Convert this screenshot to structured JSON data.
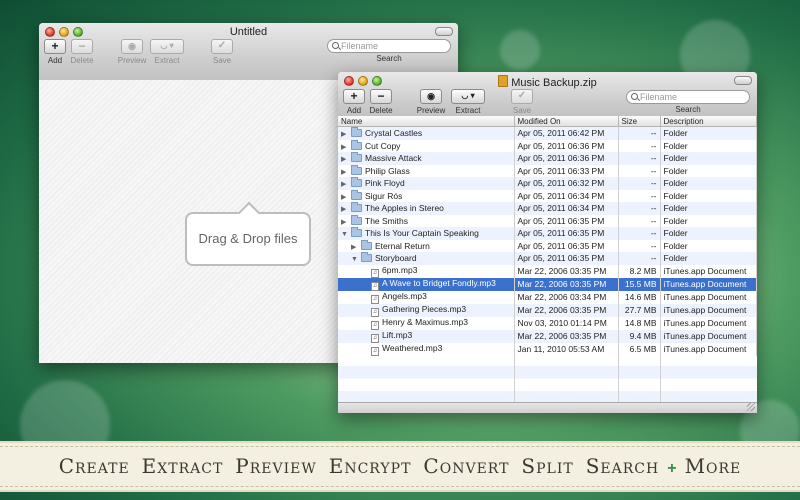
{
  "left_window": {
    "title": "Untitled",
    "toolbar": {
      "add": "Add",
      "delete": "Delete",
      "preview": "Preview",
      "extract": "Extract",
      "save": "Save"
    },
    "search": {
      "placeholder": "Filename",
      "label": "Search"
    },
    "drop_text": "Drag & Drop files"
  },
  "right_window": {
    "title": "Music Backup.zip",
    "toolbar": {
      "add": "Add",
      "delete": "Delete",
      "preview": "Preview",
      "extract": "Extract",
      "save": "Save"
    },
    "search": {
      "placeholder": "Filename",
      "label": "Search"
    },
    "columns": {
      "name": "Name",
      "modified": "Modified On",
      "size": "Size",
      "description": "Description"
    },
    "rows": [
      {
        "name": "Crystal Castles",
        "modified": "Apr 05, 2011 06:42 PM",
        "size": "--",
        "description": "Folder",
        "kind": "folder",
        "indent": 0,
        "disclosure": "closed"
      },
      {
        "name": "Cut Copy",
        "modified": "Apr 05, 2011 06:36 PM",
        "size": "--",
        "description": "Folder",
        "kind": "folder",
        "indent": 0,
        "disclosure": "closed"
      },
      {
        "name": "Massive Attack",
        "modified": "Apr 05, 2011 06:36 PM",
        "size": "--",
        "description": "Folder",
        "kind": "folder",
        "indent": 0,
        "disclosure": "closed"
      },
      {
        "name": "Philip Glass",
        "modified": "Apr 05, 2011 06:33 PM",
        "size": "--",
        "description": "Folder",
        "kind": "folder",
        "indent": 0,
        "disclosure": "closed"
      },
      {
        "name": "Pink Floyd",
        "modified": "Apr 05, 2011 06:32 PM",
        "size": "--",
        "description": "Folder",
        "kind": "folder",
        "indent": 0,
        "disclosure": "closed"
      },
      {
        "name": "Sigur Rós",
        "modified": "Apr 05, 2011 06:34 PM",
        "size": "--",
        "description": "Folder",
        "kind": "folder",
        "indent": 0,
        "disclosure": "closed"
      },
      {
        "name": "The Apples in Stereo",
        "modified": "Apr 05, 2011 06:34 PM",
        "size": "--",
        "description": "Folder",
        "kind": "folder",
        "indent": 0,
        "disclosure": "closed"
      },
      {
        "name": "The Smiths",
        "modified": "Apr 05, 2011 06:35 PM",
        "size": "--",
        "description": "Folder",
        "kind": "folder",
        "indent": 0,
        "disclosure": "closed"
      },
      {
        "name": "This Is Your Captain Speaking",
        "modified": "Apr 05, 2011 06:35 PM",
        "size": "--",
        "description": "Folder",
        "kind": "folder",
        "indent": 0,
        "disclosure": "open"
      },
      {
        "name": "Eternal Return",
        "modified": "Apr 05, 2011 06:35 PM",
        "size": "--",
        "description": "Folder",
        "kind": "folder",
        "indent": 1,
        "disclosure": "closed"
      },
      {
        "name": "Storyboard",
        "modified": "Apr 05, 2011 06:35 PM",
        "size": "--",
        "description": "Folder",
        "kind": "folder",
        "indent": 1,
        "disclosure": "open"
      },
      {
        "name": "6pm.mp3",
        "modified": "Mar 22, 2006 03:35 PM",
        "size": "8.2 MB",
        "description": "iTunes.app Document",
        "kind": "file",
        "indent": 2,
        "disclosure": "none"
      },
      {
        "name": "A Wave to Bridget Fondly.mp3",
        "modified": "Mar 22, 2006 03:35 PM",
        "size": "15.5 MB",
        "description": "iTunes.app Document",
        "kind": "file",
        "indent": 2,
        "disclosure": "none",
        "selected": true
      },
      {
        "name": "Angels.mp3",
        "modified": "Mar 22, 2006 03:34 PM",
        "size": "14.6 MB",
        "description": "iTunes.app Document",
        "kind": "file",
        "indent": 2,
        "disclosure": "none"
      },
      {
        "name": "Gathering Pieces.mp3",
        "modified": "Mar 22, 2006 03:35 PM",
        "size": "27.7 MB",
        "description": "iTunes.app Document",
        "kind": "file",
        "indent": 2,
        "disclosure": "none"
      },
      {
        "name": "Henry & Maximus.mp3",
        "modified": "Nov 03, 2010 01:14 PM",
        "size": "14.8 MB",
        "description": "iTunes.app Document",
        "kind": "file",
        "indent": 2,
        "disclosure": "none"
      },
      {
        "name": "Lift.mp3",
        "modified": "Mar 22, 2006 03:35 PM",
        "size": "9.4 MB",
        "description": "iTunes.app Document",
        "kind": "file",
        "indent": 2,
        "disclosure": "none"
      },
      {
        "name": "Weathered.mp3",
        "modified": "Jan 11, 2010 05:53 AM",
        "size": "6.5 MB",
        "description": "iTunes.app Document",
        "kind": "file",
        "indent": 2,
        "disclosure": "none"
      }
    ]
  },
  "banner": {
    "features": [
      "Create",
      "Extract",
      "Preview",
      "Encrypt",
      "Convert",
      "Split",
      "Search"
    ],
    "plus": "+",
    "more": "More"
  }
}
